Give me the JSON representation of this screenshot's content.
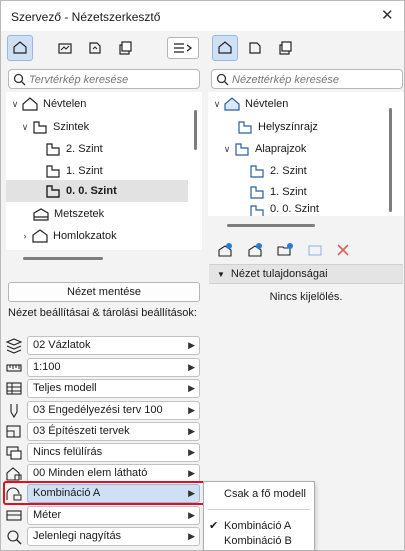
{
  "window": {
    "title": "Szervező - Nézetszerkesztő",
    "close_glyph": "✕"
  },
  "left_panel": {
    "search_placeholder": "Tervtérkép keresése",
    "tree": [
      {
        "label": "Névtelen",
        "chev": "∨",
        "icon": "house-icon"
      },
      {
        "label": "Szintek",
        "chev": "∨",
        "icon": "floor-plan-icon"
      },
      {
        "label": "2. Szint",
        "chev": "",
        "icon": "floor-plan-icon"
      },
      {
        "label": "1. Szint",
        "chev": "",
        "icon": "floor-plan-icon"
      },
      {
        "label": "0. 0. Szint",
        "chev": "",
        "icon": "floor-plan-icon",
        "selected": true
      },
      {
        "label": "Metszetek",
        "chev": "",
        "icon": "section-icon"
      },
      {
        "label": "Homlokzatok",
        "chev": "›",
        "icon": "elevation-icon"
      }
    ],
    "save_button": "Nézet mentése",
    "settings_label": "Nézet beállításai & tárolási beállítások:",
    "settings": [
      {
        "value": "02 Vázlatok",
        "icon": "layers-icon"
      },
      {
        "value": "1:100",
        "icon": "scale-icon"
      },
      {
        "value": "Teljes modell",
        "icon": "structure-display-icon"
      },
      {
        "value": "03 Engedélyezési terv 100",
        "icon": "pen-set-icon"
      },
      {
        "value": "03 Építészeti tervek",
        "icon": "model-view-icon"
      },
      {
        "value": "Nincs felülírás",
        "icon": "override-icon"
      },
      {
        "value": "00 Minden elem látható",
        "icon": "renovation-icon"
      },
      {
        "value": "Kombináció A",
        "icon": "dimension-combination-icon",
        "highlight": true
      },
      {
        "value": "Méter",
        "icon": "dimension-icon"
      },
      {
        "value": "Jelenlegi nagyítás",
        "icon": "zoom-icon"
      }
    ]
  },
  "right_panel": {
    "search_placeholder": "Nézettérkép keresése",
    "tree": [
      {
        "label": "Névtelen",
        "chev": "∨",
        "icon": "house-icon"
      },
      {
        "label": "Helyszínrajz",
        "chev": "",
        "icon": "floor-plan-icon"
      },
      {
        "label": "Alaprajzok",
        "chev": "∨",
        "icon": "floor-plan-icon"
      },
      {
        "label": "2. Szint",
        "chev": "",
        "icon": "floor-plan-icon"
      },
      {
        "label": "1. Szint",
        "chev": "",
        "icon": "floor-plan-icon"
      },
      {
        "label": "0. 0. Szint",
        "chev": "",
        "icon": "floor-plan-icon"
      }
    ],
    "properties_header": "Nézet tulajdonságai",
    "no_selection": "Nincs kijelölés."
  },
  "popup": {
    "items": [
      {
        "label": "Csak a fő modell",
        "checked": false
      },
      {
        "label": "Kombináció A",
        "checked": true
      },
      {
        "label": "Kombináció B",
        "checked": false
      }
    ],
    "check_glyph": "✔"
  },
  "colors": {
    "accent": "#cfe0f5",
    "highlight_outline": "#e01020",
    "delete_icon": "#e06060"
  }
}
